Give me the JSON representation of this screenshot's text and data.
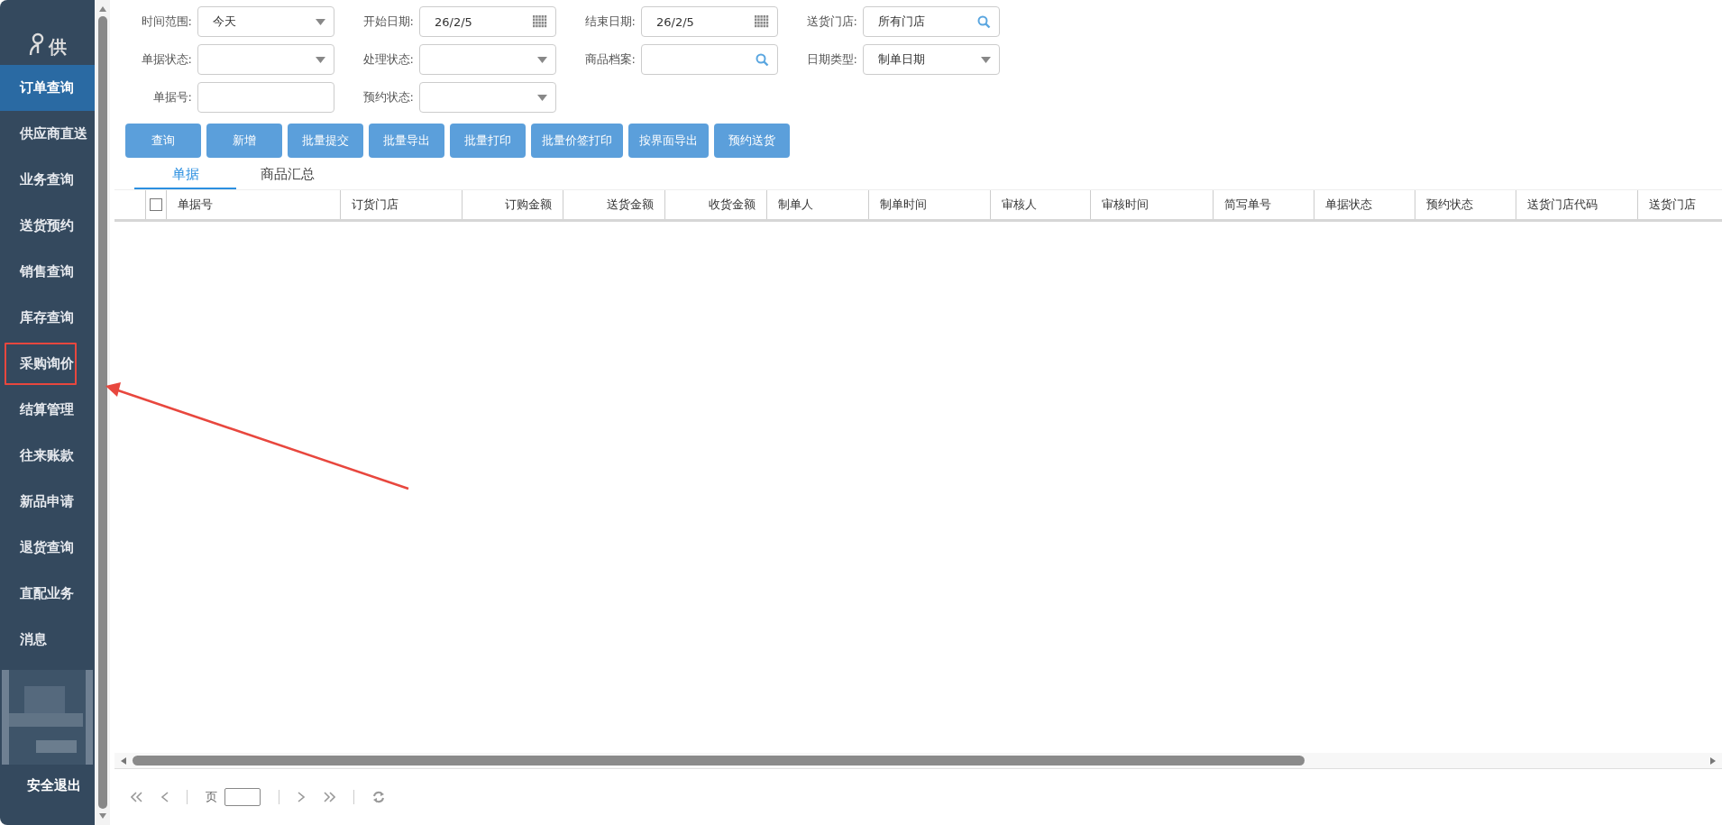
{
  "sidebar": {
    "logo_text": "供",
    "items": [
      {
        "label": "订单查询",
        "selected": true
      },
      {
        "label": "供应商直送",
        "selected": false
      },
      {
        "label": "业务查询",
        "selected": false
      },
      {
        "label": "送货预约",
        "selected": false
      },
      {
        "label": "销售查询",
        "selected": false
      },
      {
        "label": "库存查询",
        "selected": false
      },
      {
        "label": "采购询价",
        "selected": false,
        "highlighted": true
      },
      {
        "label": "结算管理",
        "selected": false
      },
      {
        "label": "往来账款",
        "selected": false
      },
      {
        "label": "新品申请",
        "selected": false
      },
      {
        "label": "退货查询",
        "selected": false
      },
      {
        "label": "直配业务",
        "selected": false
      },
      {
        "label": "消息",
        "selected": false
      }
    ],
    "logout": "安全退出"
  },
  "filters": [
    [
      {
        "label": "时间范围:",
        "kind": "select",
        "value": "今天"
      },
      {
        "label": "开始日期:",
        "kind": "date",
        "value": "26/2/5"
      },
      {
        "label": "结束日期:",
        "kind": "date",
        "value": "26/2/5"
      },
      {
        "label": "送货门店:",
        "kind": "search",
        "placeholder": "所有门店"
      }
    ],
    [
      {
        "label": "单据状态:",
        "kind": "select"
      },
      {
        "label": "处理状态:",
        "kind": "select"
      },
      {
        "label": "商品档案:",
        "kind": "search"
      },
      {
        "label": "日期类型:",
        "kind": "select",
        "value": "制单日期"
      }
    ],
    [
      {
        "label": "单据号:",
        "kind": "text"
      },
      {
        "label": "预约状态:",
        "kind": "select"
      }
    ]
  ],
  "buttons": [
    "查询",
    "新增",
    "批量提交",
    "批量导出",
    "批量打印",
    "批量价签打印",
    "按界面导出",
    "预约送货"
  ],
  "tabs": [
    {
      "label": "单据",
      "selected": true
    },
    {
      "label": "商品汇总",
      "selected": false
    }
  ],
  "table": {
    "select_all_checked": false,
    "columns": [
      {
        "label": "单据号",
        "kind": "text"
      },
      {
        "label": "订货门店",
        "kind": "text"
      },
      {
        "label": "订购金额",
        "kind": "amount"
      },
      {
        "label": "送货金额",
        "kind": "amount"
      },
      {
        "label": "收货金额",
        "kind": "amount"
      },
      {
        "label": "制单人",
        "kind": "text"
      },
      {
        "label": "制单时间",
        "kind": "text"
      },
      {
        "label": "审核人",
        "kind": "text"
      },
      {
        "label": "审核时间",
        "kind": "text"
      },
      {
        "label": "简写单号",
        "kind": "text"
      },
      {
        "label": "单据状态",
        "kind": "text"
      },
      {
        "label": "预约状态",
        "kind": "text"
      },
      {
        "label": "送货门店代码",
        "kind": "text"
      },
      {
        "label": "送货门店",
        "kind": "text"
      }
    ]
  },
  "pager": {
    "page_label": "页"
  }
}
